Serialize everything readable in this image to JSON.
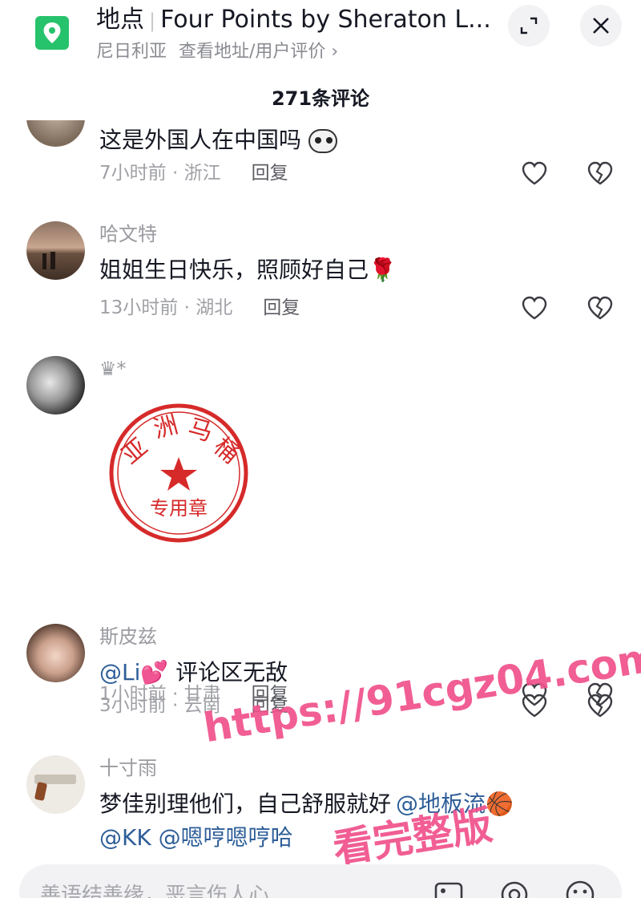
{
  "header": {
    "title_prefix": "地点",
    "title_place": "Four Points by Sheraton L...",
    "location_country": "尼日利亚",
    "subtitle_link": "查看地址/用户评价 ›",
    "icons": [
      "location-pin-icon",
      "expand-icon",
      "close-icon"
    ]
  },
  "comment_count": "271条评论",
  "comments": [
    {
      "text": "这是外国人在中国吗",
      "time": "7小时前 · 浙江",
      "reply": "回复"
    },
    {
      "user": "哈文特",
      "text": "姐姐生日快乐，照顾好自己",
      "emoji": "🌹",
      "time": "13小时前 · 湖北",
      "reply": "回复"
    },
    {
      "user": "♛*",
      "seal_text_top": "亚洲马桶",
      "seal_text_bottom": "专用章",
      "time": "1小时前 · 甘肃",
      "reply": "回复"
    },
    {
      "user": "斯皮兹",
      "mention": "@Li",
      "emoji": "💕",
      "text": " 评论区无敌",
      "time": "3小时前 · 云南",
      "reply": "回复"
    },
    {
      "user": "十寸雨",
      "text": "梦佳别理他们，自己舒服就好",
      "mention1": "@地板流",
      "emoji": "🏀",
      "mention2": "@KK @嗯哼嗯哼哈"
    }
  ],
  "watermark": {
    "line1": "https://91cgz04.com",
    "line2": "看完整版"
  },
  "input": {
    "placeholder": "善语结善缘，恶言伤人心",
    "icons": [
      "image-icon",
      "at-icon",
      "emoji-icon"
    ]
  },
  "colors": {
    "accent_green": "#27c26c",
    "mention_blue": "#2e5e98",
    "seal_red": "#d62a2a",
    "watermark_pink": "#f0518a"
  }
}
